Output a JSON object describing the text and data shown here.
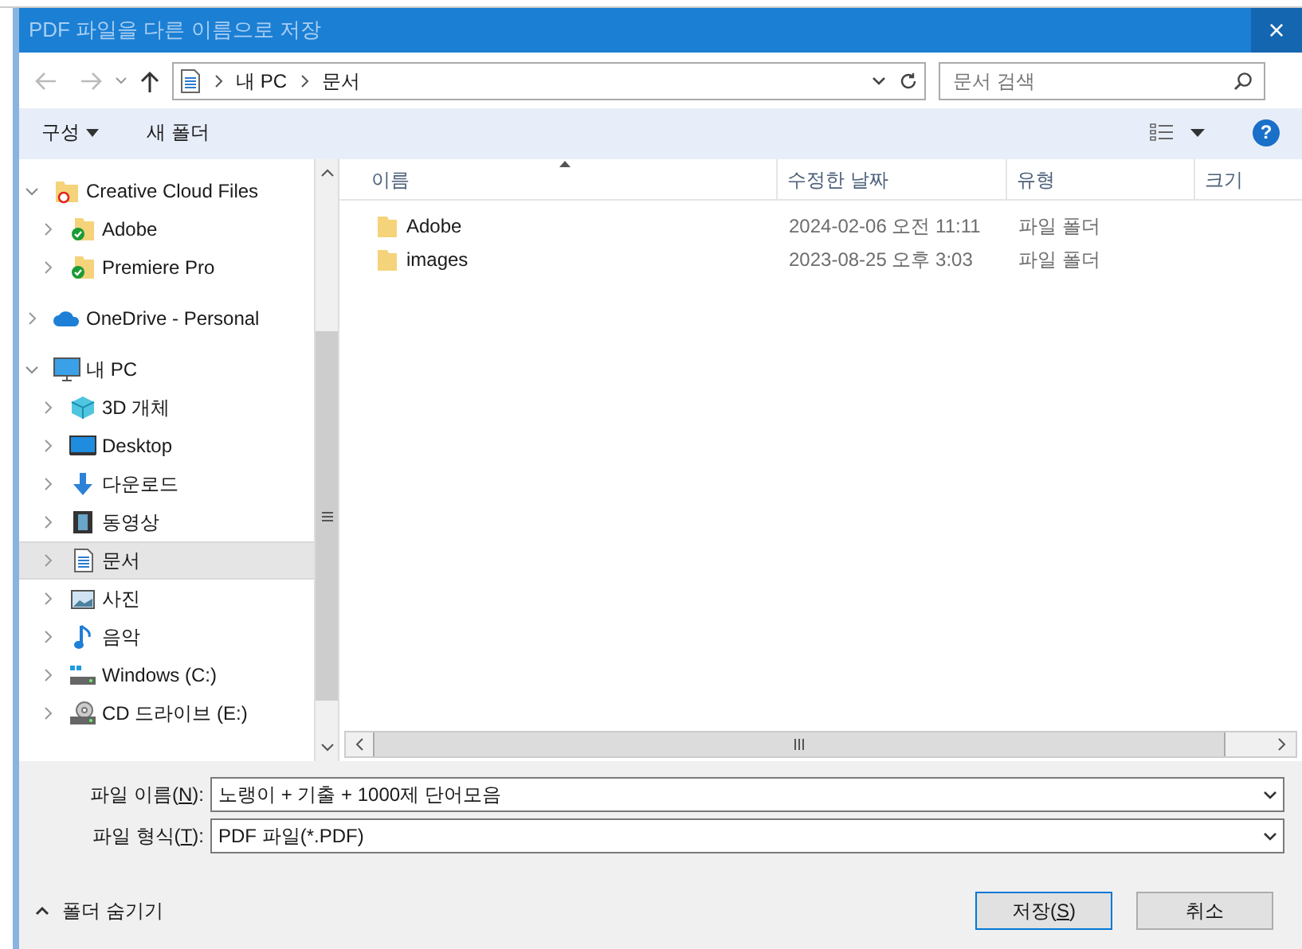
{
  "window": {
    "title": "PDF 파일을 다른 이름으로 저장",
    "close": "×"
  },
  "nav": {
    "path": [
      "내 PC",
      "문서"
    ],
    "search_placeholder": "문서 검색"
  },
  "toolbar": {
    "organize": "구성",
    "new_folder": "새 폴더",
    "help": "?"
  },
  "sidebar": {
    "items": [
      {
        "label": "Creative Cloud Files",
        "kind": "cc-folder",
        "expanded": true,
        "selected": false,
        "children": [
          {
            "label": "Adobe",
            "kind": "synced-folder",
            "expanded": false,
            "selected": false
          },
          {
            "label": "Premiere Pro",
            "kind": "synced-folder",
            "expanded": false,
            "selected": false
          }
        ]
      },
      {
        "label": "OneDrive - Personal",
        "kind": "cloud",
        "expanded": false,
        "selected": false
      },
      {
        "label": "내 PC",
        "kind": "pc",
        "expanded": true,
        "selected": false,
        "children": [
          {
            "label": "3D 개체",
            "kind": "cube",
            "expanded": false,
            "selected": false
          },
          {
            "label": "Desktop",
            "kind": "desktop",
            "expanded": false,
            "selected": false
          },
          {
            "label": "다운로드",
            "kind": "download",
            "expanded": false,
            "selected": false
          },
          {
            "label": "동영상",
            "kind": "film",
            "expanded": false,
            "selected": false
          },
          {
            "label": "문서",
            "kind": "document",
            "expanded": false,
            "selected": true
          },
          {
            "label": "사진",
            "kind": "picture",
            "expanded": false,
            "selected": false
          },
          {
            "label": "음악",
            "kind": "music",
            "expanded": false,
            "selected": false
          },
          {
            "label": "Windows (C:)",
            "kind": "drive",
            "expanded": false,
            "selected": false
          },
          {
            "label": "CD 드라이브 (E:)",
            "kind": "cd",
            "expanded": false,
            "selected": false
          }
        ]
      }
    ]
  },
  "table": {
    "columns": [
      "이름",
      "수정한 날짜",
      "유형",
      "크기"
    ],
    "rows": [
      {
        "name": "Adobe",
        "date": "2024-02-06 오전 11:11",
        "type": "파일 폴더"
      },
      {
        "name": "images",
        "date": "2023-08-25 오후 3:03",
        "type": "파일 폴더"
      }
    ]
  },
  "form": {
    "fields": [
      {
        "label": "파일 이름(",
        "mnemonic": "N",
        "suffix": "):",
        "value": "노랭이 + 기출 + 1000제 단어모음"
      },
      {
        "label": "파일 형식(",
        "mnemonic": "T",
        "suffix": "):",
        "value": "PDF 파일(*.PDF)"
      }
    ]
  },
  "hide_folders": "폴더 숨기기",
  "buttons": [
    {
      "label": "저장(",
      "mnemonic": "S",
      "suffix": ")",
      "default": true
    },
    {
      "label": "취소",
      "default": false
    }
  ]
}
